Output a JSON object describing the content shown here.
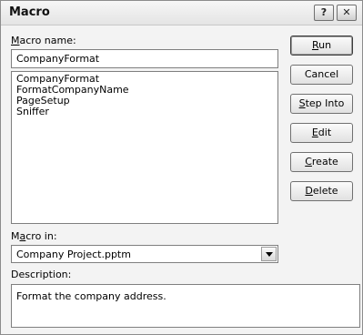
{
  "dialog": {
    "title": "Macro",
    "help_button": "?",
    "close_button": "✕"
  },
  "macro_name": {
    "label_access": "M",
    "label_rest": "acro name:",
    "value": "CompanyFormat"
  },
  "macro_list": {
    "items": [
      "CompanyFormat",
      "FormatCompanyName",
      "PageSetup",
      "Sniffer"
    ]
  },
  "macro_in": {
    "label_pre": "M",
    "label_access": "a",
    "label_rest": "cro in:",
    "selected": "Company Project.pptm"
  },
  "description": {
    "label": "Description:",
    "value": "Format the company address."
  },
  "buttons": {
    "run": {
      "access": "R",
      "rest": "un"
    },
    "cancel": {
      "label": "Cancel"
    },
    "step_into": {
      "access": "S",
      "rest": "tep Into"
    },
    "edit": {
      "access": "E",
      "rest": "dit"
    },
    "create": {
      "access": "C",
      "rest": "reate"
    },
    "delete": {
      "access": "D",
      "rest": "elete"
    }
  }
}
